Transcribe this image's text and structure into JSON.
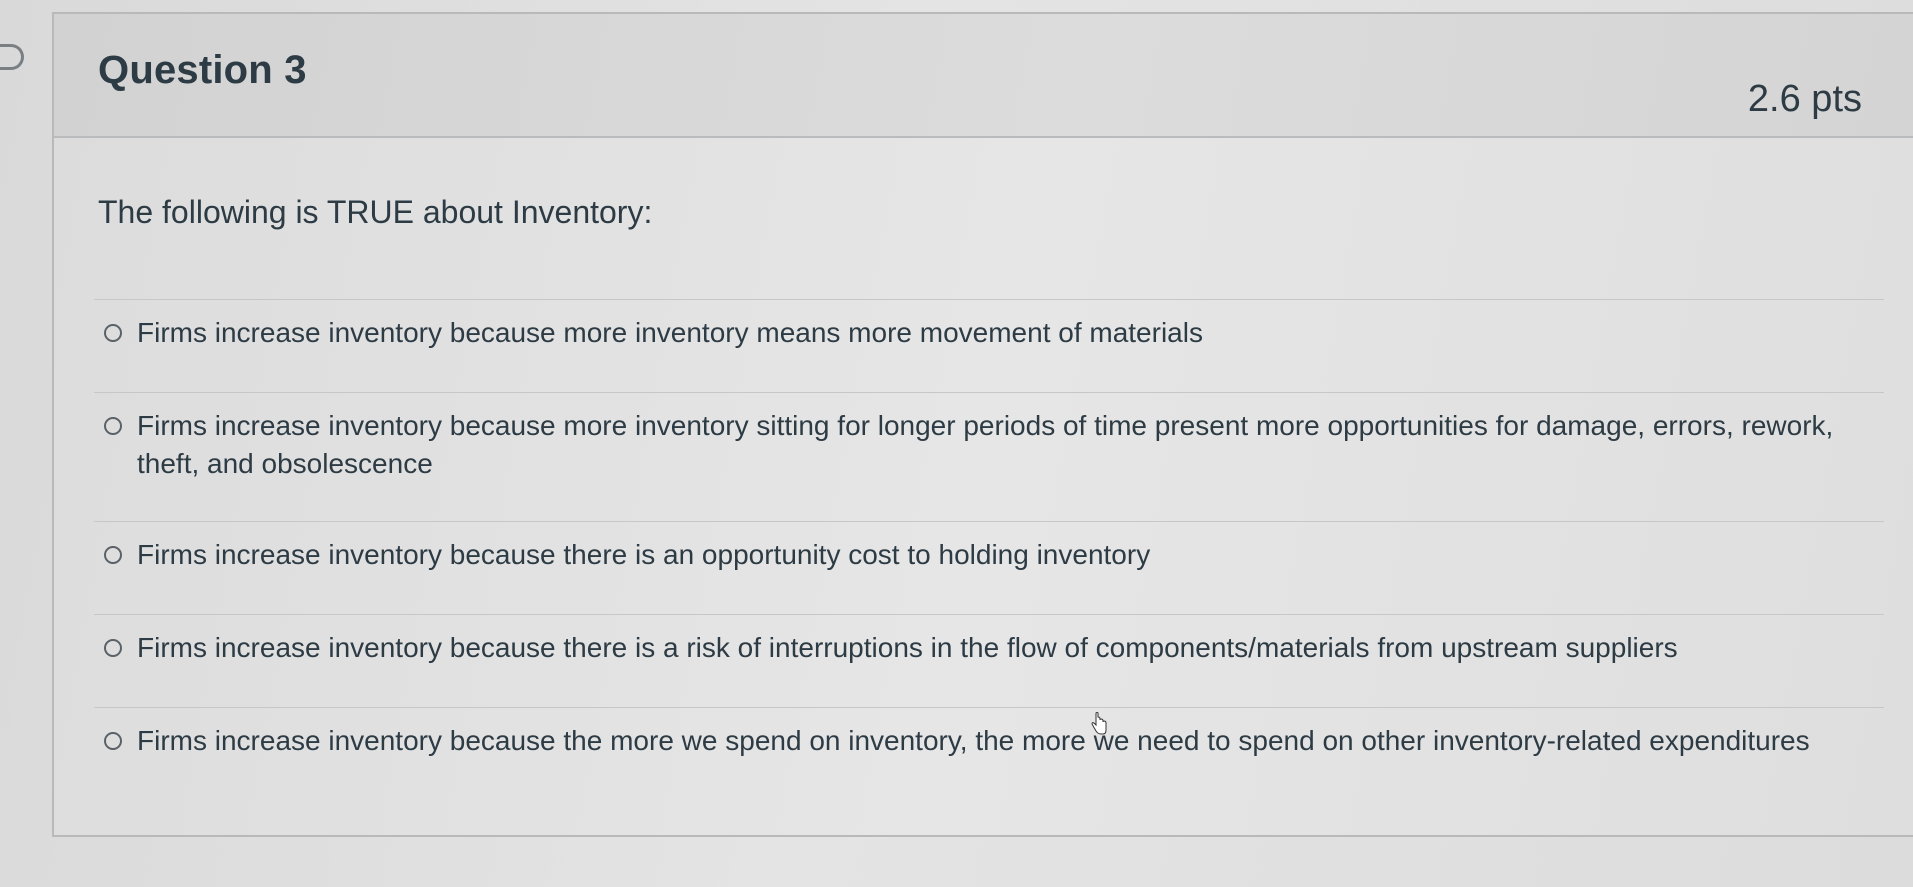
{
  "question": {
    "title": "Question 3",
    "points": "2.6 pts",
    "prompt": "The following is TRUE about Inventory:"
  },
  "answers": [
    {
      "label": "Firms increase inventory because more inventory means more movement of materials",
      "selected": false
    },
    {
      "label": "Firms increase inventory because more inventory sitting for longer periods of time present more opportunities for damage, errors, rework, theft, and obsolescence",
      "selected": false
    },
    {
      "label": "Firms increase inventory because there is an opportunity cost to holding inventory",
      "selected": false
    },
    {
      "label": "Firms increase inventory because there is a risk of interruptions in the flow of components/materials from upstream suppliers",
      "selected": false
    },
    {
      "label": "Firms increase inventory because the more we spend on inventory, the more we need to spend on other inventory-related expenditures",
      "selected": false
    }
  ],
  "icons": {
    "flag": "flag-icon",
    "cursor": "hand-pointer-icon"
  }
}
